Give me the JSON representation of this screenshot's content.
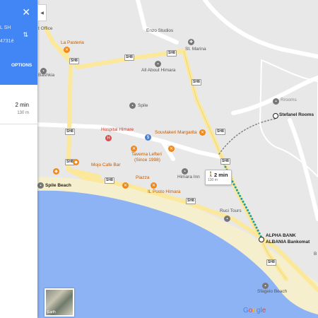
{
  "panel": {
    "line1": "L SH",
    "line2": "4731é",
    "options_label": "OPTIONS",
    "route_duration": "2 min",
    "route_distance": "130 m",
    "colors": {
      "header": "#4285f4"
    }
  },
  "map": {
    "places": {
      "post_office": "t Office",
      "la_pasteria": "La Pasteria",
      "bashkia": "Bashkia",
      "enzo_studios": "Enzo Studios",
      "st_marina": "St. Marina",
      "all_about_himara": "All About Himara",
      "spile": "Spile",
      "hospital": "Hospital Himare",
      "souvlakeri": "Souvlakeri Margarita",
      "taverna_line1": "Taverna Lefteri",
      "taverna_line2": "(Since 1998)",
      "mojo": "Mojo Cafe Bar",
      "spile_beach": "Spile Beach",
      "piazza": "Piazza",
      "himara_inn": "Himara Inn",
      "il_posto": "IL Posto Himara",
      "ruci_tours": "Ruci Tours",
      "rrooms": "Rrooms",
      "stefanel_rooms": "Stefanel Rooms",
      "alpha_bank_line1": "ALPHA BANK",
      "alpha_bank_line2": "ALBANIA Bankomat",
      "sfageio_beach": "Sfageio Beach",
      "b_edge": "B"
    },
    "road_shield": "SH8",
    "walk_badge": {
      "duration": "2 min",
      "distance": "130 m"
    },
    "earth_label": "Earth",
    "google_logo": [
      "G",
      "o",
      "o",
      "g",
      "l",
      "e"
    ],
    "google_colors": [
      "#4285f4",
      "#ea4335",
      "#fbbc05",
      "#4285f4",
      "#34a853",
      "#ea4335"
    ],
    "colors": {
      "land": "#e8e8e8",
      "beach": "#f6efcd",
      "sea": "#8db3f5",
      "road_main": "#fbe89a",
      "road_minor": "#ffffff",
      "route": "#1a9fa8"
    }
  }
}
